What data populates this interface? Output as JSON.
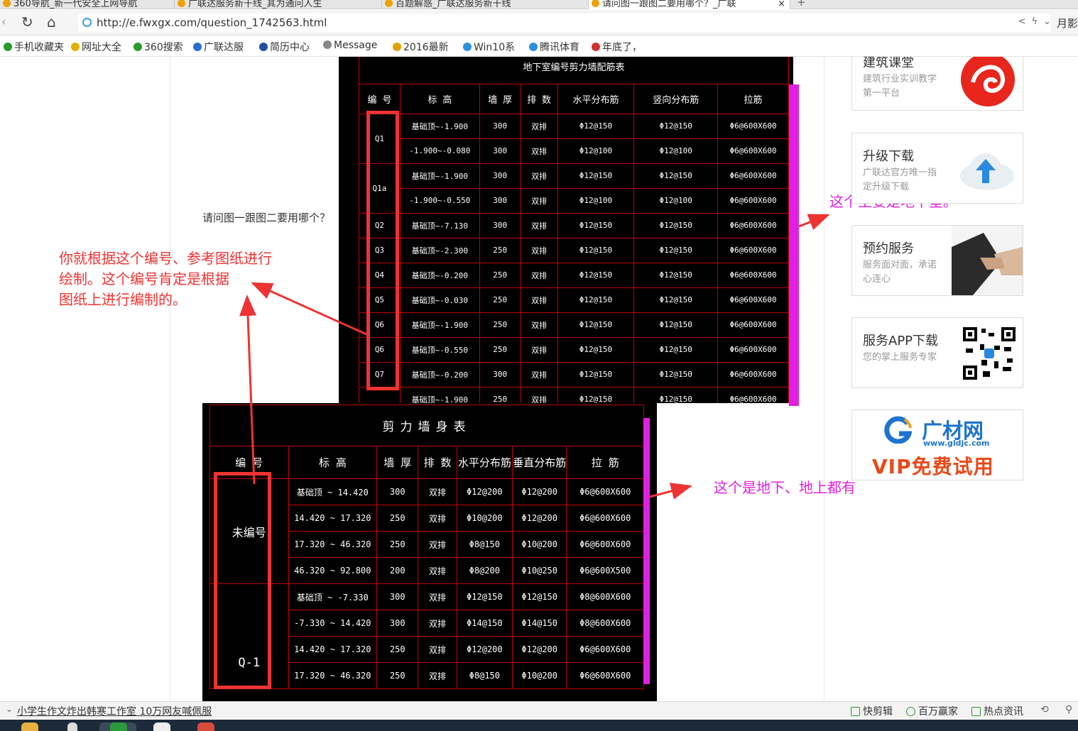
{
  "browser": {
    "tabs": [
      "360导航_新一代安全上网导航",
      "广联达服务新干线_其为通问人生",
      "百题解惑_广联达服务新干线",
      "请问图一跟图二要用哪个？_广联"
    ],
    "new_tab": "+",
    "url": "http://e.fwxgx.com/question_1742563.html",
    "user": "月影"
  },
  "bookmarks": [
    {
      "label": "手机收藏夹",
      "color": "#2a9a2a"
    },
    {
      "label": "网址大全",
      "color": "#e0b000"
    },
    {
      "label": "360搜索",
      "color": "#2a9a2a"
    },
    {
      "label": "广联达服",
      "color": "#2a6fd0"
    },
    {
      "label": "简历中心",
      "color": "#2050a0"
    },
    {
      "label": "Message",
      "color": "#888888"
    },
    {
      "label": "2016最新",
      "color": "#e0a000"
    },
    {
      "label": "Win10系",
      "color": "#2a90e0"
    },
    {
      "label": "腾讯体育",
      "color": "#2a90e0"
    },
    {
      "label": "年底了，",
      "color": "#d03030"
    }
  ],
  "question": "请问图一跟图二要用哪个？",
  "table1": {
    "title": "地下室编号剪力墙配筋表",
    "headers": [
      "编 号",
      "标 高",
      "墙 厚",
      "排 数",
      "水平分布筋",
      "竖向分布筋",
      "拉筋"
    ],
    "rows": [
      [
        "Q1",
        "基础顶~-1.900",
        "300",
        "双排",
        "Φ12@150",
        "Φ12@150",
        "Φ6@600X600"
      ],
      [
        "",
        "-1.900~-0.080",
        "300",
        "双排",
        "Φ12@100",
        "Φ12@100",
        "Φ6@600X600"
      ],
      [
        "Q1a",
        "基础顶~-1.900",
        "300",
        "双排",
        "Φ12@150",
        "Φ12@150",
        "Φ6@600X600"
      ],
      [
        "",
        "-1.900~-0.550",
        "300",
        "双排",
        "Φ12@100",
        "Φ12@100",
        "Φ6@600X600"
      ],
      [
        "Q2",
        "基础顶~-7.130",
        "300",
        "双排",
        "Φ12@150",
        "Φ12@150",
        "Φ6@600X600"
      ],
      [
        "Q3",
        "基础顶~-2.300",
        "250",
        "双排",
        "Φ12@150",
        "Φ12@150",
        "Φ6@600X600"
      ],
      [
        "Q4",
        "基础顶~-0.200",
        "250",
        "双排",
        "Φ12@150",
        "Φ12@150",
        "Φ6@600X600"
      ],
      [
        "Q5",
        "基础顶~-0.030",
        "250",
        "双排",
        "Φ12@150",
        "Φ12@150",
        "Φ6@600X600"
      ],
      [
        "Q6",
        "基础顶~-1.900",
        "250",
        "双排",
        "Φ12@150",
        "Φ12@150",
        "Φ6@600X600"
      ],
      [
        "Q6",
        "基础顶~-0.550",
        "250",
        "双排",
        "Φ12@150",
        "Φ12@150",
        "Φ6@600X600"
      ],
      [
        "Q7",
        "基础顶~-0.200",
        "300",
        "双排",
        "Φ12@150",
        "Φ12@150",
        "Φ6@600X600"
      ],
      [
        "",
        "基础顶~-1.900",
        "250",
        "双排",
        "Φ12@150",
        "Φ12@150",
        "Φ6@600X600"
      ]
    ]
  },
  "table2": {
    "title": "剪力墙身表",
    "headers": [
      "编 号",
      "标 高",
      "墙 厚",
      "排 数",
      "水平分布筋",
      "垂直分布筋",
      "拉 筋"
    ],
    "group1": "未编号",
    "group2": "Q-1",
    "rows": [
      [
        "基础顶 ~ 14.420",
        "300",
        "双排",
        "Φ12@200",
        "Φ12@200",
        "Φ6@600X600"
      ],
      [
        "14.420 ~ 17.320",
        "250",
        "双排",
        "Φ10@200",
        "Φ12@200",
        "Φ6@600X600"
      ],
      [
        "17.320 ~ 46.320",
        "250",
        "双排",
        "Φ8@150",
        "Φ10@200",
        "Φ6@600X600"
      ],
      [
        "46.320 ~ 92.800",
        "200",
        "双排",
        "Φ8@200",
        "Φ10@250",
        "Φ6@600X500"
      ],
      [
        "基础顶 ~ -7.330",
        "300",
        "双排",
        "Φ12@150",
        "Φ12@150",
        "Φ8@600X600"
      ],
      [
        "-7.330 ~ 14.420",
        "300",
        "双排",
        "Φ14@150",
        "Φ14@150",
        "Φ8@600X600"
      ],
      [
        "14.420 ~ 17.320",
        "250",
        "双排",
        "Φ12@200",
        "Φ12@200",
        "Φ6@600X600"
      ],
      [
        "17.320 ~ 46.320",
        "250",
        "双排",
        "Φ8@150",
        "Φ10@200",
        "Φ6@600X600"
      ]
    ]
  },
  "annotations": {
    "main_line1": "你就根据这个编号、参考图纸进行",
    "main_line2": "绘制。这个编号肯定是根据",
    "main_line3": "图纸上进行编制的。",
    "right1": "这个主要是地下室。",
    "right2": "这个是地下、地上都有",
    "main_color": "#ee3333",
    "right_color": "#e020e0"
  },
  "sidebar": [
    {
      "title": "建筑课堂",
      "desc": "建筑行业实训教学第一平台",
      "icon": "red-swirl-icon"
    },
    {
      "title": "升级下载",
      "desc": "广联达官方唯一指定升级下载",
      "icon": "cloud-upload-icon"
    },
    {
      "title": "预约服务",
      "desc": "服务面对面，承诺心连心",
      "icon": "handshake-icon"
    },
    {
      "title": "服务APP下载",
      "desc": "您的掌上服务专家",
      "icon": "qr-code-icon"
    }
  ],
  "ad": {
    "brand": "广材网",
    "domain": "www.gldjc.com",
    "slogan": "VIP免费试用"
  },
  "status": {
    "news": "小学生作文炸出韩寒工作室 10万网友喊佩服",
    "items": [
      "快剪辑",
      "百万赢家",
      "热点资讯"
    ]
  }
}
